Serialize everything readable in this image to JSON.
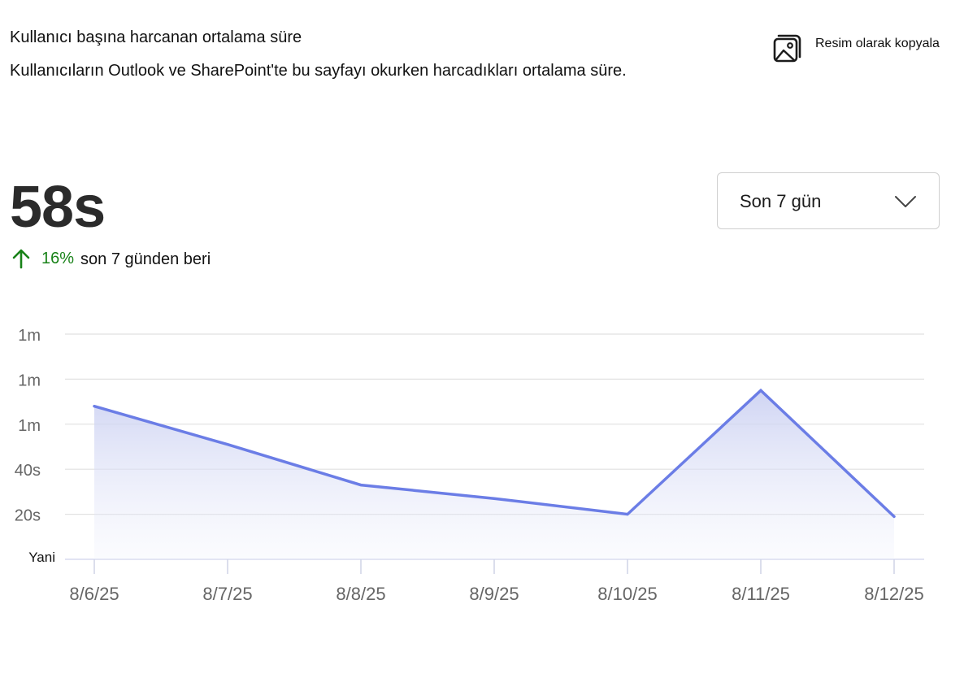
{
  "header": {
    "title": "Kullanıcı başına harcanan ortalama süre",
    "subtitle": "Kullanıcıların Outlook ve SharePoint'te bu sayfayı okurken harcadıkları ortalama süre.",
    "copy_label": "Resim olarak kopyala",
    "copy_icon": "image-icon"
  },
  "metric": {
    "value": "58s",
    "trend_icon": "arrow-up-icon",
    "trend_percent": "16%",
    "trend_text": "son 7 günden beri",
    "trend_color": "#188218"
  },
  "range_select": {
    "selected": "Son 7 gün",
    "icon": "chevron-down-icon"
  },
  "chart_data": {
    "type": "area",
    "x": [
      "8/6/25",
      "8/7/25",
      "8/8/25",
      "8/9/25",
      "8/10/25",
      "8/11/25",
      "8/12/25"
    ],
    "series": [
      {
        "values": [
          68,
          51,
          33,
          27,
          20,
          75,
          19
        ],
        "color": "#6b7de6"
      }
    ],
    "y_ticks": [
      {
        "value": 0,
        "label": "Yani"
      },
      {
        "value": 20,
        "label": "20s"
      },
      {
        "value": 40,
        "label": "40s"
      },
      {
        "value": 60,
        "label": "1m"
      },
      {
        "value": 80,
        "label": "1m"
      },
      {
        "value": 100,
        "label": "1m"
      }
    ],
    "ylim": [
      0,
      100
    ],
    "grid": true,
    "title": "",
    "xlabel": "",
    "ylabel": ""
  }
}
